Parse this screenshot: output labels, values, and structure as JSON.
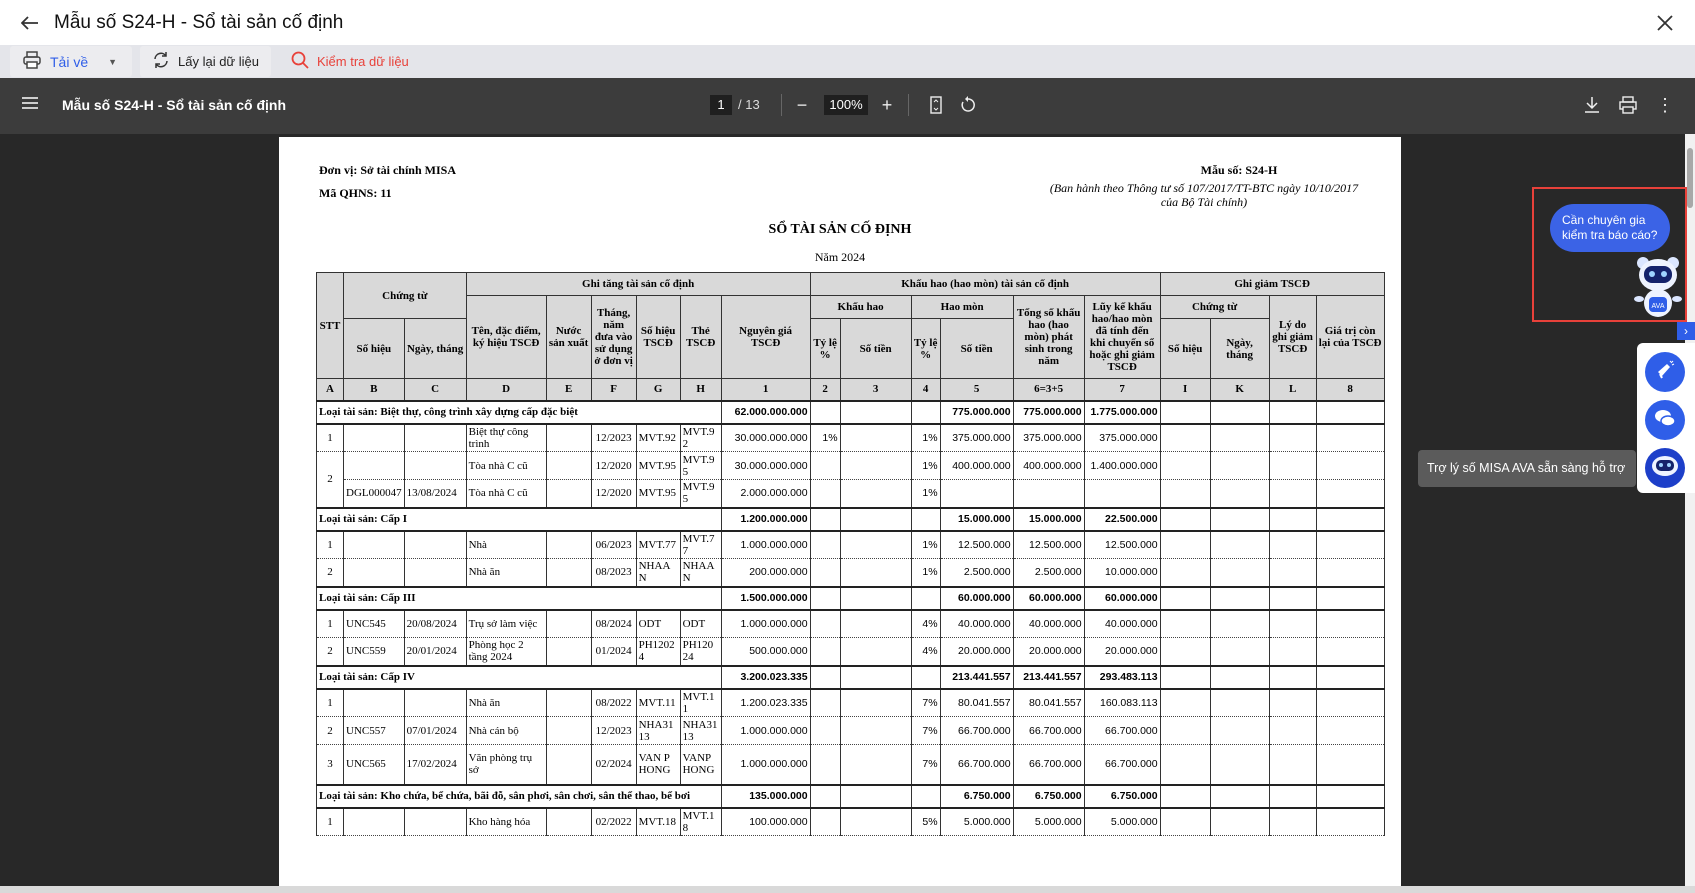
{
  "window": {
    "title": "Mẫu số S24-H - Sổ tài sản cố định"
  },
  "toolbar": {
    "download_label": "Tải về",
    "refresh_label": "Lấy lại dữ liệu",
    "check_label": "Kiểm tra dữ liệu"
  },
  "viewer": {
    "title": "Mẫu số S24-H - Sổ tài sản cố định",
    "page": "1",
    "total_pages": "/ 13",
    "zoom": "100%"
  },
  "doc": {
    "unit": "Đơn vị: Sở tài chính MISA",
    "qhns": "Mã QHNS: 11",
    "form_no": "Mẫu số: S24-H",
    "issued_by": "(Ban hành theo Thông tư số 107/2017/TT-BTC ngày 10/10/2017 của Bộ Tài chính)",
    "title": "SỔ TÀI SẢN CỐ ĐỊNH",
    "year": "Năm 2024"
  },
  "table": {
    "h": {
      "stt": "STT",
      "chung_tu": "Chứng từ",
      "ghi_tang": "Ghi tăng tài sản cố định",
      "khau_hao_group": "Khấu hao (hao mòn) tài sản cố định",
      "ghi_giam": "Ghi giảm TSCĐ",
      "so_hieu": "Số hiệu",
      "ngay_thang": "Ngày, tháng",
      "ten": "Tên, đặc điểm, ký hiệu TSCĐ",
      "nuoc": "Nước sản xuất",
      "thang_nam": "Tháng, năm đưa vào sử dụng ở đơn vị",
      "so_hieu_tscd": "Số hiệu TSCĐ",
      "the_tscd": "Thẻ TSCĐ",
      "nguyen_gia": "Nguyên giá TSCĐ",
      "khau_hao": "Khấu hao",
      "hao_mon": "Hao mòn",
      "ty_le": "Tỷ lệ %",
      "so_tien": "Số tiền",
      "tong": "Tổng số khấu hao (hao mòn) phát sinh trong năm",
      "luy_ke": "Lũy kế khấu hao/hao mòn đã tính đến khi chuyển sổ hoặc ghi giảm TSCĐ",
      "gg_chung_tu": "Chứng từ",
      "gg_so_hieu": "Số hiệu",
      "gg_ngay": "Ngày, tháng",
      "ly_do": "Lý do ghi giảm TSCĐ",
      "gia_tri_con": "Giá trị còn lại của TSCĐ"
    },
    "letters": [
      "A",
      "B",
      "C",
      "D",
      "E",
      "F",
      "G",
      "H",
      "1",
      "2",
      "3",
      "4",
      "5",
      "6=3+5",
      "7",
      "I",
      "K",
      "L",
      "8"
    ],
    "groups": [
      {
        "label": "Loại tài sản: Biệt thự, công trình xây dựng cấp đặc biệt",
        "nguyen_gia": "62.000.000.000",
        "hm_so_tien": "775.000.000",
        "tong": "775.000.000",
        "luy_ke": "1.775.000.000",
        "rows": [
          {
            "stt": "1",
            "so_hieu": "",
            "ngay": "",
            "ten": "Biệt thự công trình",
            "thang": "12/2023",
            "so_hieu_tscd": "MVT.92",
            "the": "MVT.92",
            "nguyen_gia": "30.000.000.000",
            "kh_ty_le": "1%",
            "hm_ty_le": "1%",
            "hm_so_tien": "375.000.000",
            "tong": "375.000.000",
            "luy_ke": "375.000.000"
          },
          {
            "stt": "2",
            "stt_span": 2,
            "so_hieu": "",
            "ngay": "",
            "ten": "Tòa nhà C cũ",
            "thang": "12/2020",
            "so_hieu_tscd": "MVT.95",
            "the": "MVT.95",
            "nguyen_gia": "30.000.000.000",
            "kh_ty_le": "",
            "hm_ty_le": "1%",
            "hm_so_tien": "400.000.000",
            "tong": "400.000.000",
            "luy_ke": "1.400.000.000"
          },
          {
            "stt": null,
            "so_hieu": "DGL000047",
            "ngay": "13/08/2024",
            "ten": "Tòa nhà C cũ",
            "thang": "12/2020",
            "so_hieu_tscd": "MVT.95",
            "the": "MVT.95",
            "nguyen_gia": "2.000.000.000",
            "kh_ty_le": "",
            "hm_ty_le": "1%",
            "hm_so_tien": "",
            "tong": "",
            "luy_ke": ""
          }
        ]
      },
      {
        "label": "Loại tài sản: Cấp I",
        "nguyen_gia": "1.200.000.000",
        "hm_so_tien": "15.000.000",
        "tong": "15.000.000",
        "luy_ke": "22.500.000",
        "rows": [
          {
            "stt": "1",
            "so_hieu": "",
            "ngay": "",
            "ten": "Nhà",
            "thang": "06/2023",
            "so_hieu_tscd": "MVT.77",
            "the": "MVT.77",
            "nguyen_gia": "1.000.000.000",
            "kh_ty_le": "",
            "hm_ty_le": "1%",
            "hm_so_tien": "12.500.000",
            "tong": "12.500.000",
            "luy_ke": "12.500.000"
          },
          {
            "stt": "2",
            "so_hieu": "",
            "ngay": "",
            "ten": "Nhà ăn",
            "thang": "08/2023",
            "so_hieu_tscd": "NHAAN",
            "the": "NHAAN",
            "nguyen_gia": "200.000.000",
            "kh_ty_le": "",
            "hm_ty_le": "1%",
            "hm_so_tien": "2.500.000",
            "tong": "2.500.000",
            "luy_ke": "10.000.000"
          }
        ]
      },
      {
        "label": "Loại tài sản: Cấp III",
        "nguyen_gia": "1.500.000.000",
        "hm_so_tien": "60.000.000",
        "tong": "60.000.000",
        "luy_ke": "60.000.000",
        "rows": [
          {
            "stt": "1",
            "so_hieu": "UNC545",
            "ngay": "20/08/2024",
            "ten": "Trụ sở làm việc",
            "thang": "08/2024",
            "so_hieu_tscd": "ODT",
            "the": "ODT",
            "nguyen_gia": "1.000.000.000",
            "kh_ty_le": "",
            "hm_ty_le": "4%",
            "hm_so_tien": "40.000.000",
            "tong": "40.000.000",
            "luy_ke": "40.000.000"
          },
          {
            "stt": "2",
            "so_hieu": "UNC559",
            "ngay": "20/01/2024",
            "ten": "Phòng học 2 tầng 2024",
            "thang": "01/2024",
            "so_hieu_tscd": "PH12024",
            "the": "PH12024",
            "nguyen_gia": "500.000.000",
            "kh_ty_le": "",
            "hm_ty_le": "4%",
            "hm_so_tien": "20.000.000",
            "tong": "20.000.000",
            "luy_ke": "20.000.000"
          }
        ]
      },
      {
        "label": "Loại tài sản: Cấp IV",
        "nguyen_gia": "3.200.023.335",
        "hm_so_tien": "213.441.557",
        "tong": "213.441.557",
        "luy_ke": "293.483.113",
        "rows": [
          {
            "stt": "1",
            "so_hieu": "",
            "ngay": "",
            "ten": "Nhà ăn",
            "thang": "08/2022",
            "so_hieu_tscd": "MVT.11",
            "the": "MVT.11",
            "nguyen_gia": "1.200.023.335",
            "kh_ty_le": "",
            "hm_ty_le": "7%",
            "hm_so_tien": "80.041.557",
            "tong": "80.041.557",
            "luy_ke": "160.083.113"
          },
          {
            "stt": "2",
            "so_hieu": "UNC557",
            "ngay": "07/01/2024",
            "ten": "Nhà cán bộ",
            "thang": "12/2023",
            "so_hieu_tscd": "NHA3113",
            "the": "NHA3113",
            "nguyen_gia": "1.000.000.000",
            "kh_ty_le": "",
            "hm_ty_le": "7%",
            "hm_so_tien": "66.700.000",
            "tong": "66.700.000",
            "luy_ke": "66.700.000"
          },
          {
            "stt": "3",
            "so_hieu": "UNC565",
            "ngay": "17/02/2024",
            "ten": "Văn phòng trụ sở",
            "thang": "02/2024",
            "so_hieu_tscd": "VAN PHONG",
            "the": "VANPHONG",
            "nguyen_gia": "1.000.000.000",
            "kh_ty_le": "",
            "hm_ty_le": "7%",
            "hm_so_tien": "66.700.000",
            "tong": "66.700.000",
            "luy_ke": "66.700.000",
            "tall": true
          }
        ]
      },
      {
        "label": "Loại tài sản: Kho chứa, bể chứa, bãi đỗ, sân phơi, sân chơi, sân thể thao, bể bơi",
        "nguyen_gia": "135.000.000",
        "hm_so_tien": "6.750.000",
        "tong": "6.750.000",
        "luy_ke": "6.750.000",
        "rows": [
          {
            "stt": "1",
            "so_hieu": "",
            "ngay": "",
            "ten": "Kho hàng hóa",
            "thang": "02/2022",
            "so_hieu_tscd": "MVT.18",
            "the": "MVT.18",
            "nguyen_gia": "100.000.000",
            "kh_ty_le": "",
            "hm_ty_le": "5%",
            "hm_so_tien": "5.000.000",
            "tong": "5.000.000",
            "luy_ke": "5.000.000"
          }
        ]
      }
    ]
  },
  "assistant": {
    "bubble": "Cần chuyên gia kiểm tra báo cáo?",
    "tooltip": "Trợ lý số MISA AVA sẵn sàng hỗ trợ",
    "robot_badge": "AVA"
  },
  "colors": {
    "accent": "#2f5ee8",
    "danger": "#e8413a",
    "viewer_bar": "#3c3c3c",
    "doc_bg": "#282828"
  }
}
